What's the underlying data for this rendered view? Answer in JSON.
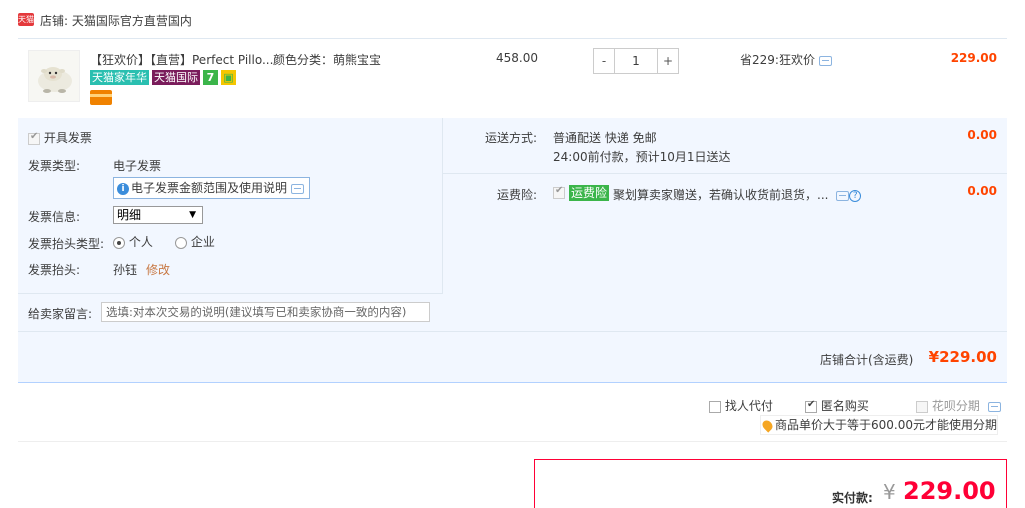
{
  "shop": {
    "logo_text": "天猫",
    "name": "店铺: 天猫国际官方直营国内"
  },
  "item": {
    "title": "【狂欢价】【直营】Perfect Pillo...",
    "attr": "颜色分类：萌熊宝宝",
    "badges": [
      "天猫家年华",
      "天猫国际",
      "7"
    ],
    "unit_price": "458.00",
    "quantity": "1",
    "qty_minus": "-",
    "qty_plus": "+",
    "promo": "省229:狂欢价",
    "subtotal": "229.00"
  },
  "invoice": {
    "open_label": "开具发票",
    "type_label": "发票类型:",
    "type_value": "电子发票",
    "tip_icon": "i",
    "tip_text": "电子发票金额范围及使用说明",
    "info_label": "发票信息:",
    "info_value": "明细",
    "head_type_label": "发票抬头类型:",
    "head_type_options": [
      "个人",
      "企业"
    ],
    "head_label": "发票抬头:",
    "head_value": "孙钰",
    "edit_label": "修改"
  },
  "message": {
    "label": "给卖家留言:",
    "placeholder": "选填:对本次交易的说明(建议填写已和卖家协商一致的内容)"
  },
  "shipping": {
    "label": "运送方式:",
    "method": "普通配送 快递 免邮",
    "eta": "24:00前付款，预计10月1日送达",
    "fee": "0.00"
  },
  "insurance": {
    "label": "运费险:",
    "tag": "运费险",
    "text": "聚划算卖家赠送，若确认收货前退货，...",
    "help": "?",
    "fee": "0.00"
  },
  "shop_total": {
    "label": "店铺合计(含运费)",
    "value": "¥229.00"
  },
  "options": {
    "proxy_pay": "找人代付",
    "anonymous": "匿名购买",
    "huabei": "花呗分期",
    "huabei_tip": "商品单价大于等于600.00元才能使用分期"
  },
  "payment": {
    "label": "实付款:",
    "currency": "¥",
    "value": "229.00"
  }
}
